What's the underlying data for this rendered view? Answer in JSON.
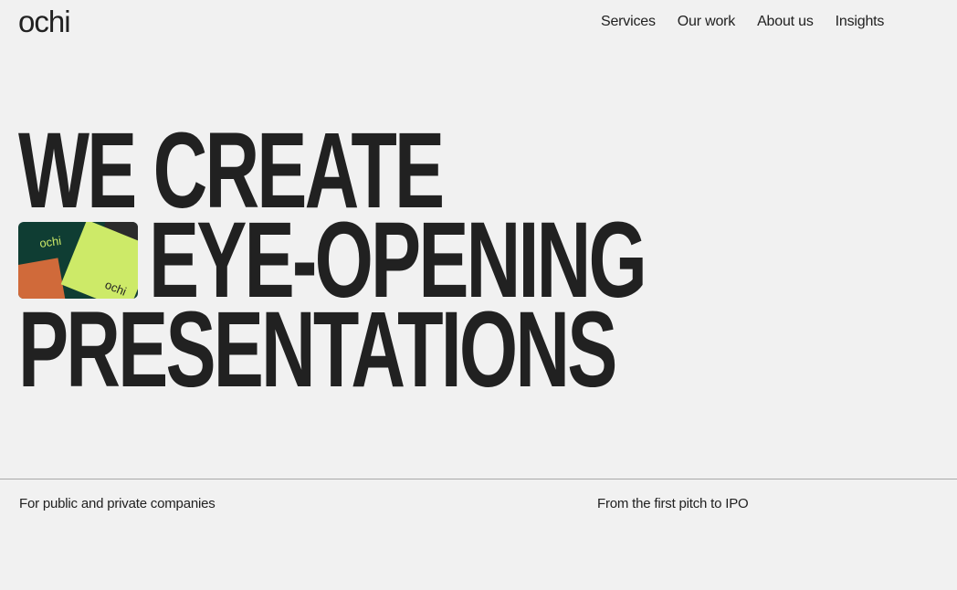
{
  "brand": {
    "logo_text": "ochi",
    "accent_color": "#cdea68",
    "dark_green": "#0f3d33",
    "orange": "#d06a3a"
  },
  "nav": {
    "items": [
      {
        "label": "Services"
      },
      {
        "label": "Our work"
      },
      {
        "label": "About us"
      },
      {
        "label": "Insights"
      }
    ]
  },
  "hero": {
    "line1": "WE CREATE",
    "line2": "EYE-OPENING",
    "line3": "PRESENTATIONS",
    "image_label": "ochi"
  },
  "footer": {
    "left_text": "For public and private companies",
    "right_text": "From the first pitch to IPO"
  }
}
